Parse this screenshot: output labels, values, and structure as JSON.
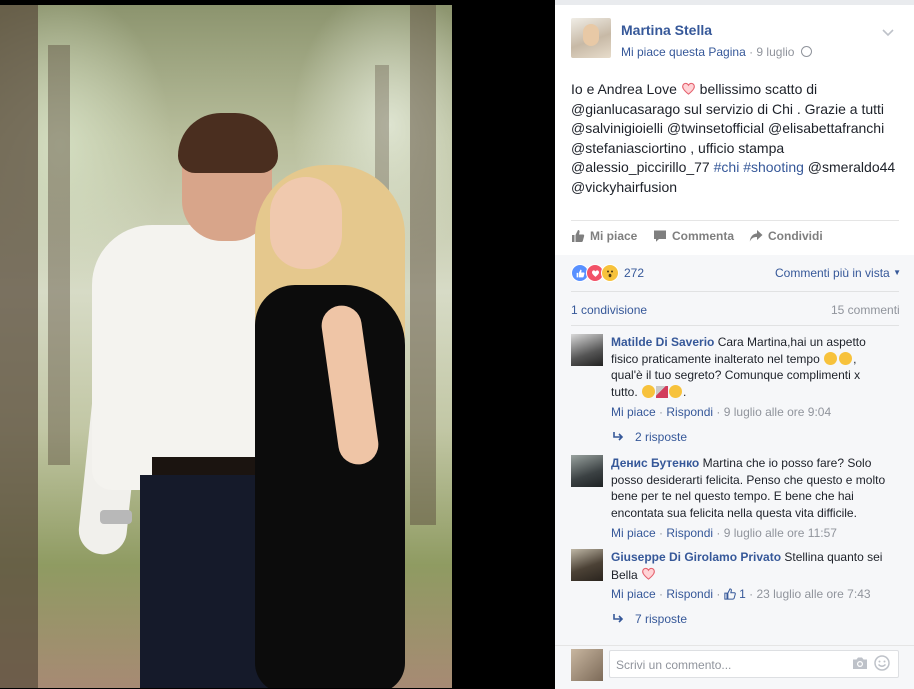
{
  "post": {
    "page_name": "Martina Stella",
    "like_page": "Mi piace questa Pagina",
    "separator": " · ",
    "date": "9 luglio",
    "text": {
      "line1a": "Io e Andrea Love",
      "line1b": " bellissimo scatto di",
      "line2": "@gianlucasarago sul servizio di Chi . Grazie a tutti",
      "line3": "@salvinigioielli @twinsetofficial @elisabettafranchi",
      "line4": "@stefaniasciortino , ufficio stampa",
      "line5a": "@alessio_piccirillo_77 ",
      "hashtag1": "#chi",
      "hashtag2": "#shooting",
      "line5b": " @smeraldo44",
      "line6": "@vickyhairfusion"
    }
  },
  "actions": {
    "like": "Mi piace",
    "comment": "Commenta",
    "share": "Condividi"
  },
  "stats": {
    "reactions_count": "272",
    "sort_label": "Commenti più in vista",
    "shares": "1 condivisione",
    "comments": "15 commenti"
  },
  "comments": [
    {
      "author": "Matilde Di Saverio",
      "text1": " Cara Martina,hai un aspetto",
      "text2": "fisico praticamente inalterato nel tempo ",
      "text3": "qual'è il tuo segreto? Comunque complimenti x",
      "text4": "tutto. ",
      "like": "Mi piace",
      "reply": "Rispondi",
      "time": "9 luglio alle ore 9:04",
      "replies": "2 risposte"
    },
    {
      "author": "Денис Бутенко",
      "text1": " Martina che io posso fare? Solo",
      "text2": "posso desiderarti felicita. Penso che questo e molto",
      "text3": "bene per te nel questo tempo. E bene che hai",
      "text4": "encontata sua felicita nella questa vita difficile.",
      "like": "Mi piace",
      "reply": "Rispondi",
      "time": "9 luglio alle ore 11:57"
    },
    {
      "author": "Giuseppe Di Girolamo Privato",
      "text1": " Stellina quanto sei",
      "text2": "Bella ",
      "like": "Mi piace",
      "reply": "Rispondi",
      "likes_count": "1",
      "time": "23 luglio alle ore 7:43",
      "replies": "7 risposte"
    }
  ],
  "composer": {
    "placeholder": "Scrivi un commento..."
  },
  "colors": {
    "link": "#365899",
    "like_blue": "#5890ff",
    "love_red": "#f25268",
    "wow_yellow": "#f7c23c"
  }
}
